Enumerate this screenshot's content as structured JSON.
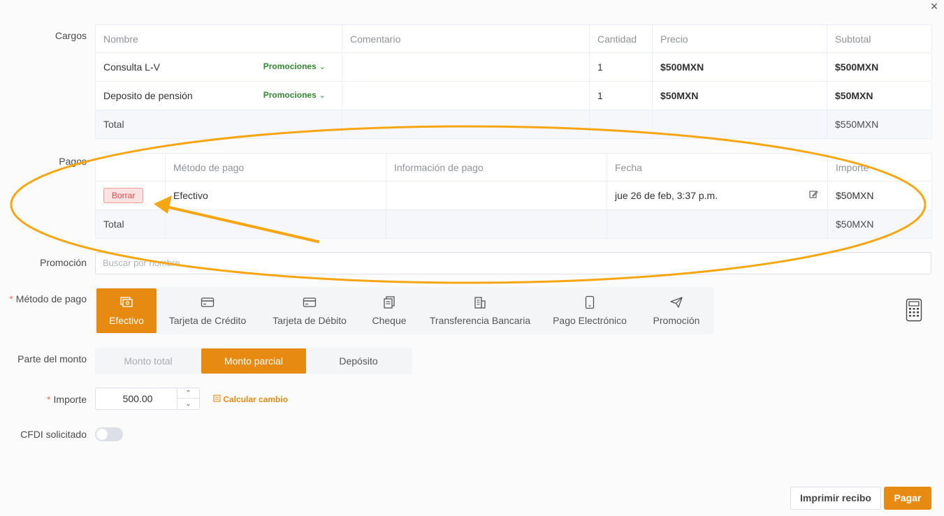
{
  "close_glyph": "×",
  "cargos": {
    "label": "Cargos",
    "headers": [
      "Nombre",
      "Comentario",
      "Cantidad",
      "Precio",
      "Subtotal"
    ],
    "rows": [
      {
        "nombre": "Consulta L-V",
        "promo": "Promociones",
        "comentario": "",
        "cantidad": "1",
        "precio": "$500MXN",
        "subtotal": "$500MXN"
      },
      {
        "nombre": "Deposito de pensión",
        "promo": "Promociones",
        "comentario": "",
        "cantidad": "1",
        "precio": "$50MXN",
        "subtotal": "$50MXN"
      }
    ],
    "total_label": "Total",
    "total_value": "$550MXN"
  },
  "pagos": {
    "label": "Pagos",
    "headers": [
      "",
      "Método de pago",
      "Información de pago",
      "Fecha",
      "Importe"
    ],
    "rows": [
      {
        "action": "Borrar",
        "metodo": "Efectivo",
        "info": "",
        "fecha": "jue 26 de feb, 3:37 p.m.",
        "importe": "$50MXN"
      }
    ],
    "total_label": "Total",
    "total_value": "$50MXN"
  },
  "promocion": {
    "label": "Promoción",
    "placeholder": "Buscar por nombre"
  },
  "metodo_pago": {
    "label": "Método de pago",
    "required_mark": "*",
    "options": [
      {
        "label": "Efectivo",
        "icon": "cash-icon"
      },
      {
        "label": "Tarjeta de Crédito",
        "icon": "credit-card-icon"
      },
      {
        "label": "Tarjeta de Débito",
        "icon": "debit-card-icon"
      },
      {
        "label": "Cheque",
        "icon": "cheque-icon"
      },
      {
        "label": "Transferencia Bancaria",
        "icon": "bank-icon"
      },
      {
        "label": "Pago Electrónico",
        "icon": "phone-icon"
      },
      {
        "label": "Promoción",
        "icon": "send-icon"
      }
    ],
    "selected": "Efectivo"
  },
  "parte_monto": {
    "label": "Parte del monto",
    "options": [
      "Monto total",
      "Monto parcial",
      "Depósito"
    ],
    "selected": "Monto parcial"
  },
  "importe": {
    "label": "Importe",
    "required_mark": "*",
    "value": "500.00",
    "calc_link": "Calcular cambio"
  },
  "cfdi": {
    "label": "CFDI solicitado",
    "enabled": false
  },
  "footer": {
    "print_label": "Imprimir recibo",
    "pay_label": "Pagar"
  },
  "colors": {
    "accent": "#e68a12",
    "annotation": "#f5a612",
    "danger": "#e0484b",
    "promo_green": "#2f8a2f"
  }
}
